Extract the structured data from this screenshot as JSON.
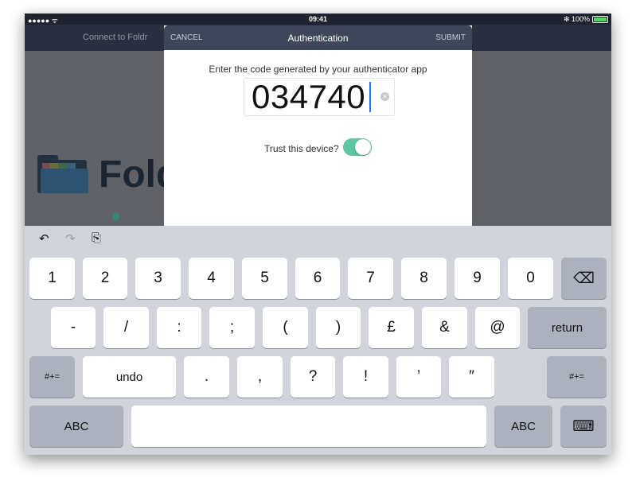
{
  "status_bar": {
    "signal": "●●●●● ᯤ",
    "time": "09:41",
    "battery": "✻ 100%"
  },
  "background": {
    "nav_title": "Connect to Foldr",
    "logo_text": "Fold"
  },
  "modal": {
    "cancel_label": "CANCEL",
    "title": "Authentication",
    "submit_label": "SUBMIT",
    "prompt": "Enter the code generated by your authenticator app",
    "code_value": "034740",
    "trust_label": "Trust this device?",
    "trust_enabled": true,
    "toggle_color": "#5ec5a5"
  },
  "keyboard": {
    "assist": {
      "undo": "↶",
      "redo": "↷",
      "paste": "⎘"
    },
    "row1": [
      "1",
      "2",
      "3",
      "4",
      "5",
      "6",
      "7",
      "8",
      "9",
      "0"
    ],
    "backspace": "⌫",
    "row2": [
      "-",
      "/",
      ":",
      ";",
      "(",
      ")",
      "£",
      "&",
      "@"
    ],
    "return_label": "return",
    "row3": {
      "shift_left": "#+=",
      "undo_label": "undo",
      "keys": [
        ".",
        ",",
        "?",
        "!",
        "’",
        "″"
      ],
      "shift_right": "#+="
    },
    "row4": {
      "abc_left": "ABC",
      "abc_right": "ABC",
      "keyboard_icon": "⌨"
    }
  }
}
